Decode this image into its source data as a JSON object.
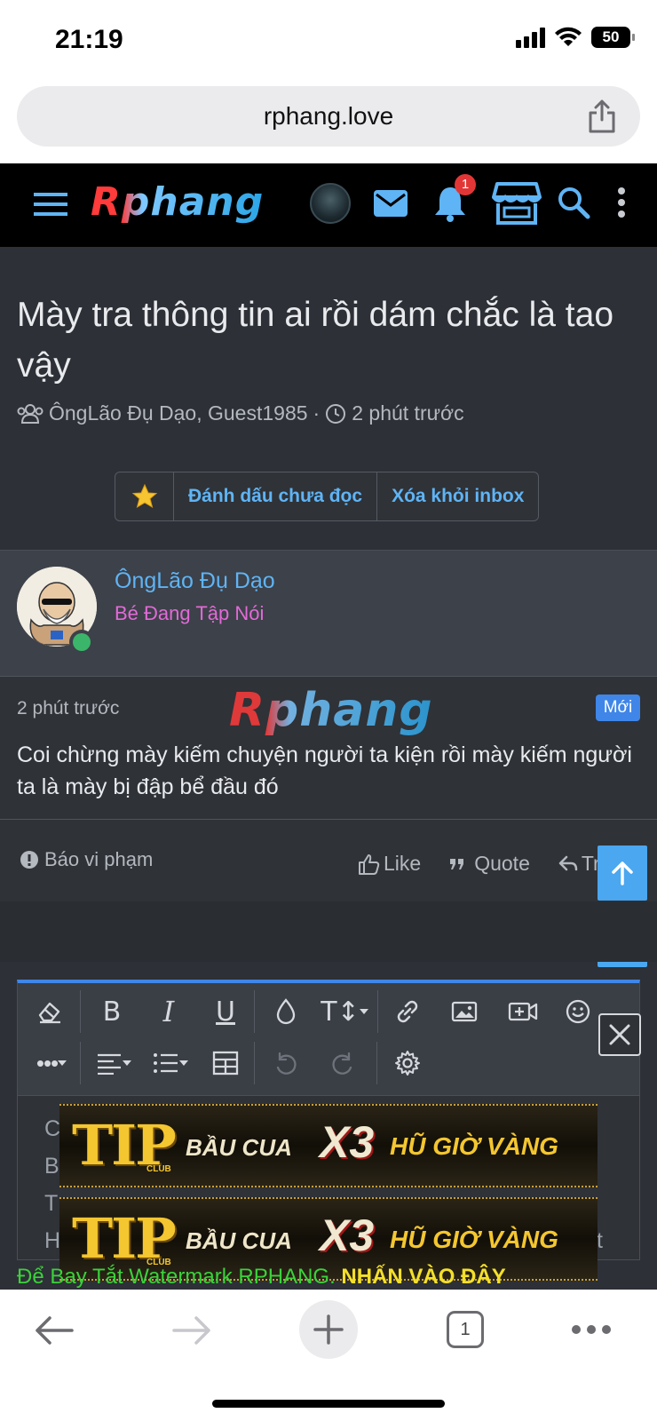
{
  "status_bar": {
    "time": "21:19",
    "battery": "50"
  },
  "browser": {
    "url": "rphang.love",
    "tab_count": "1"
  },
  "site": {
    "logo": "Rphang",
    "notification_count": "1"
  },
  "thread": {
    "title": "Mày tra thông tin ai rồi dám chắc là tao vậy",
    "participants": "ÔngLão Đụ Dạo, Guest1985",
    "time": "2 phút trước",
    "actions": {
      "mark_unread": "Đánh dấu chưa đọc",
      "remove_inbox": "Xóa khỏi inbox"
    }
  },
  "message": {
    "username": "ÔngLão Đụ Dạo",
    "user_title": "Bé Đang Tập Nói",
    "time": "2 phút trước",
    "watermark_logo": "Rphang",
    "new_badge": "Mới",
    "text": "Coi chừng mày kiếm chuyện người ta kiện rồi mày kiếm người ta là mày bị đập bể đầu đó",
    "report": "Báo vi phạm",
    "like": "Like",
    "quote": "Quote",
    "reply": "Tr"
  },
  "editor": {
    "partial_lines": [
      "C",
      "B",
      "T",
      "H"
    ],
    "partial_right": "t"
  },
  "ads": [
    {
      "brand": "TIP",
      "club": "CLUB",
      "text1": "BẦU CUA",
      "text2": "X3",
      "text3": "HŨ GIỜ VÀNG"
    },
    {
      "brand": "TIP",
      "club": "CLUB",
      "text1": "BẦU CUA",
      "text2": "X3",
      "text3": "HŨ GIỜ VÀNG"
    }
  ],
  "watermark_notice": {
    "green": "Để Bay Tắt Watermark RPHANG.",
    "yellow": "NHẤN VÀO ĐÂY"
  },
  "colors": {
    "accent_blue": "#5fb4f5",
    "user_title_pink": "#e26ad8",
    "new_badge_blue": "#3f86e8",
    "online_green": "#3bb56a",
    "notification_red": "#e23636"
  }
}
